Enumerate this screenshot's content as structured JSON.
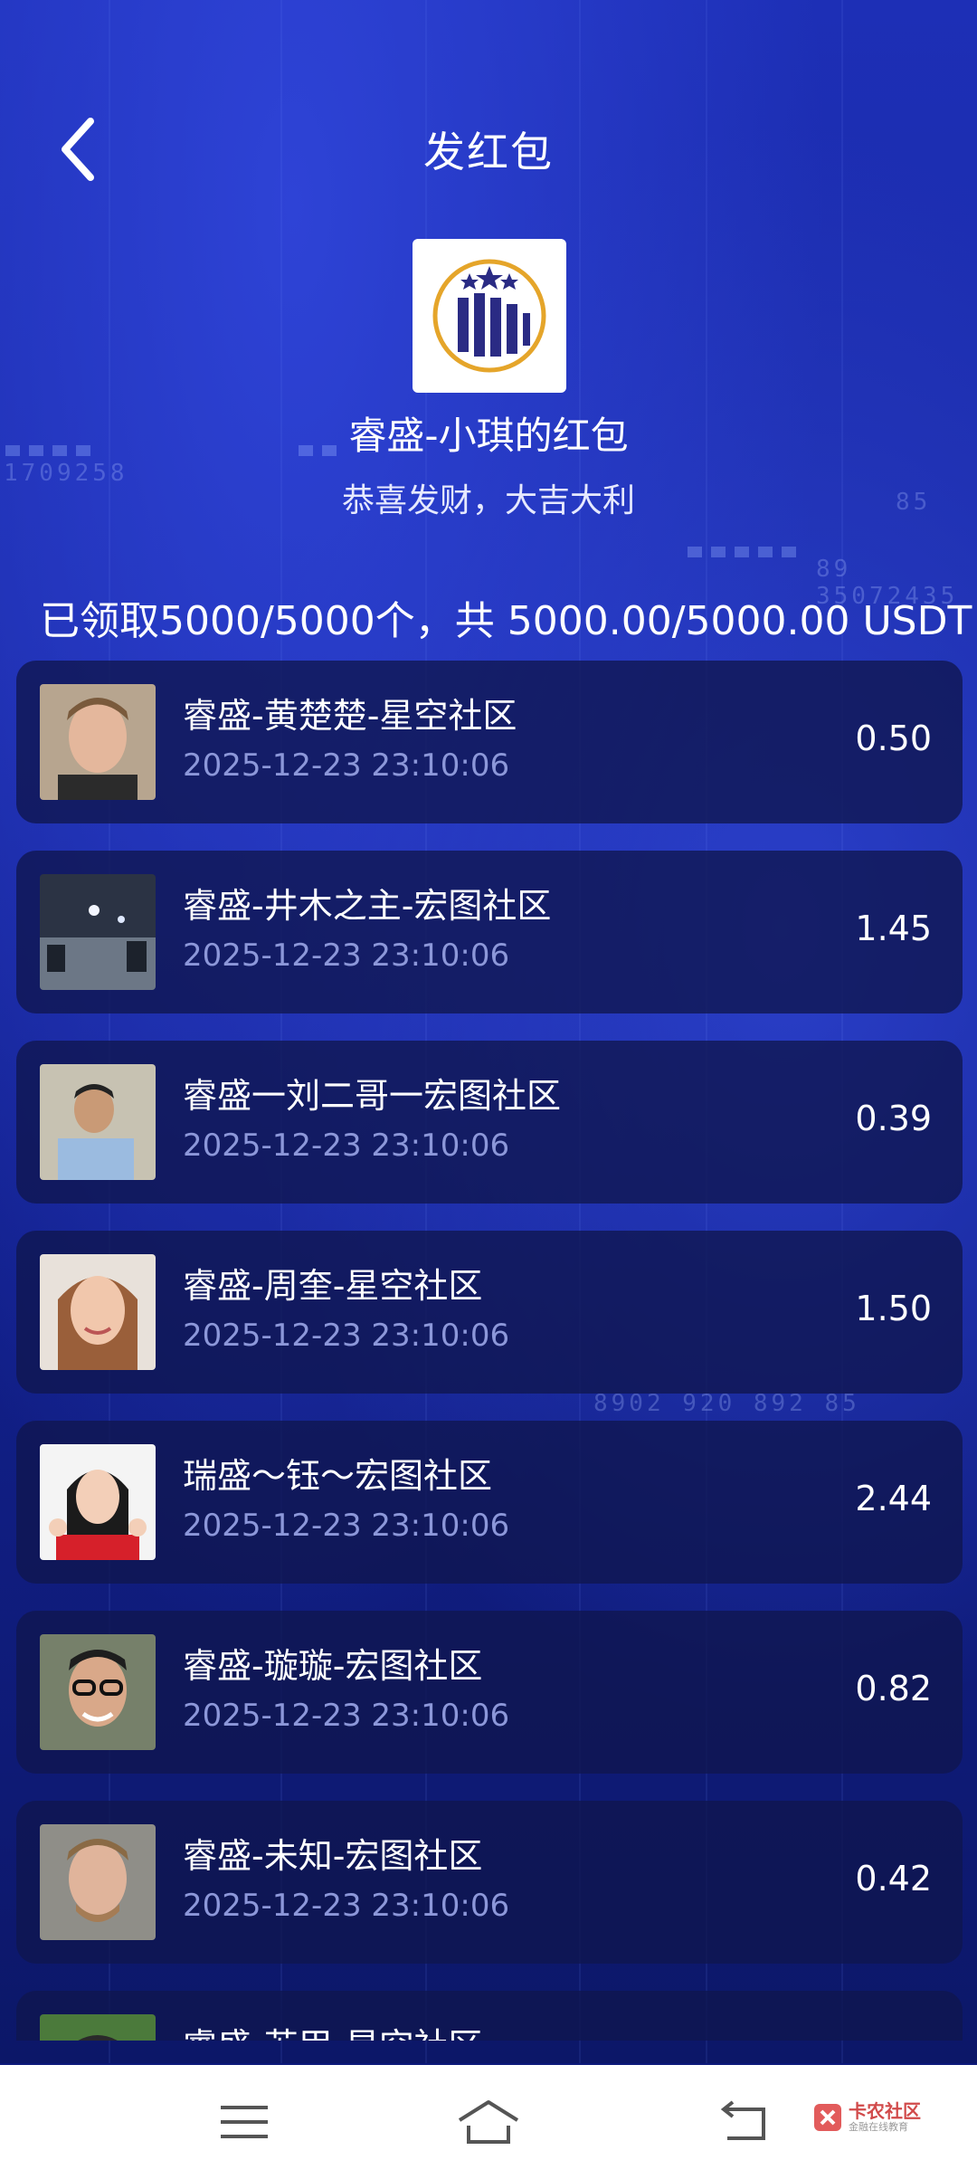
{
  "header": {
    "title": "发红包"
  },
  "packet": {
    "sender": "睿盛-小琪的红包",
    "wish": "恭喜发财，大吉大利",
    "summary": "已领取5000/5000个，共 5000.00/5000.00 USDT"
  },
  "background_ticker": [
    "1709258",
    "85",
    "89 35072435",
    "8902  920 892 85"
  ],
  "records": [
    {
      "name": "睿盛-黄楚楚-星空社区",
      "time": "2025-12-23 23:10:06",
      "amount": "0.50",
      "avatar": "man-portrait"
    },
    {
      "name": "睿盛-井木之主-宏图社区",
      "time": "2025-12-23 23:10:06",
      "amount": "1.45",
      "avatar": "night-city"
    },
    {
      "name": "睿盛一刘二哥一宏图社区",
      "time": "2025-12-23 23:10:06",
      "amount": "0.39",
      "avatar": "man-photo"
    },
    {
      "name": "睿盛-周奎-星空社区",
      "time": "2025-12-23 23:10:06",
      "amount": "1.50",
      "avatar": "woman-portrait"
    },
    {
      "name": "瑞盛～钰～宏图社区",
      "time": "2025-12-23 23:10:06",
      "amount": "2.44",
      "avatar": "girl-thumbs-up"
    },
    {
      "name": "睿盛-璇璇-宏图社区",
      "time": "2025-12-23 23:10:06",
      "amount": "0.82",
      "avatar": "man-glasses"
    },
    {
      "name": "睿盛-未知-宏图社区",
      "time": "2025-12-23 23:10:06",
      "amount": "0.42",
      "avatar": "man-portrait-2"
    },
    {
      "name": "睿盛-苏甲-星空社区",
      "time": "",
      "amount": "",
      "avatar": "man-partial"
    }
  ],
  "watermark": {
    "title": "卡农社区",
    "subtitle": "金融在线教育"
  },
  "colors": {
    "accent": "#1d2fb6",
    "card": "#10164e",
    "time_text": "#8c97d9"
  }
}
